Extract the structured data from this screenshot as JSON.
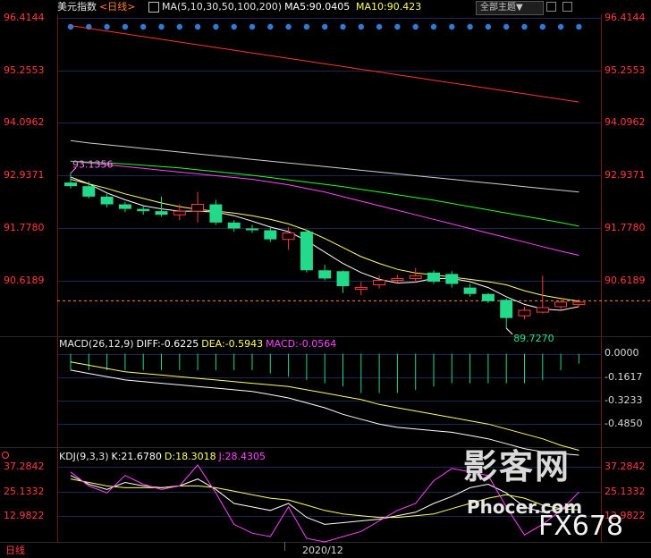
{
  "main_header": {
    "instrument": "美元指数",
    "period": "<日线>",
    "ma_label": "MA(5,10,30,50,100,200)",
    "ma5": "MA5:90.0405",
    "ma10": "MA10:90.423"
  },
  "theme_select": {
    "value": "全部主题▼"
  },
  "toolbar_icons": [
    "settings-icon",
    "close-icon"
  ],
  "price_axis_ticks": [
    "96.4144",
    "95.2553",
    "94.0962",
    "92.9371",
    "91.7780",
    "90.6189"
  ],
  "macd_header": {
    "label": "MACD(26,12,9)",
    "dif": "DIFF:-0.6225",
    "dea": "DEA:-0.5943",
    "macd": "MACD:-0.0564"
  },
  "macd_axis_ticks": [
    "0.0000",
    "-0.1617",
    "-0.3233",
    "-0.4850"
  ],
  "kdj_header": {
    "label": "KDJ(9,3,3)",
    "k": "K:21.6780",
    "d": "D:18.3018",
    "j": "J:28.4305"
  },
  "kdj_axis_ticks": [
    "37.2842",
    "25.1332",
    "12.9822"
  ],
  "footer": {
    "period_label": "日线",
    "date_label": "2020/12"
  },
  "watermark": {
    "main": "影客网",
    "site": "Phocer.com",
    "code": "FX678"
  },
  "colors": {
    "up": "#ff3b3b",
    "down": "#23d98a",
    "ma5": "#ffffff",
    "ma10": "#ffff66",
    "ma30": "#ff44ff",
    "ma50": "#22ff22",
    "ma100": "#d0d0d0",
    "ma200": "#ff3333",
    "dif": "#ffffff",
    "dea": "#ffff66",
    "k": "#ffffff",
    "d": "#ffff66",
    "j": "#ff44ff"
  },
  "chart_data": [
    {
      "type": "candlestick",
      "title": "美元指数 <日线>",
      "ylim": [
        89.55,
        96.55
      ],
      "annotations": [
        {
          "text": "93.1356",
          "kind": "high",
          "bar": 0,
          "value": 93.1356
        },
        {
          "text": "89.7270",
          "kind": "low",
          "bar": 24,
          "value": 89.727
        }
      ],
      "last_price_line": 90.33,
      "candles": [
        {
          "o": 92.93,
          "c": 92.85,
          "h": 93.1356,
          "l": 92.8
        },
        {
          "o": 92.85,
          "c": 92.62,
          "h": 92.95,
          "l": 92.58
        },
        {
          "o": 92.62,
          "c": 92.45,
          "h": 92.68,
          "l": 92.38
        },
        {
          "o": 92.45,
          "c": 92.35,
          "h": 92.5,
          "l": 92.28
        },
        {
          "o": 92.35,
          "c": 92.3,
          "h": 92.42,
          "l": 92.22
        },
        {
          "o": 92.3,
          "c": 92.22,
          "h": 92.62,
          "l": 92.18
        },
        {
          "o": 92.22,
          "c": 92.3,
          "h": 92.45,
          "l": 92.1
        },
        {
          "o": 92.3,
          "c": 92.45,
          "h": 92.72,
          "l": 92.05
        },
        {
          "o": 92.45,
          "c": 92.05,
          "h": 92.55,
          "l": 92.0
        },
        {
          "o": 92.05,
          "c": 91.92,
          "h": 92.1,
          "l": 91.85
        },
        {
          "o": 91.92,
          "c": 91.88,
          "h": 92.0,
          "l": 91.82
        },
        {
          "o": 91.88,
          "c": 91.68,
          "h": 91.95,
          "l": 91.62
        },
        {
          "o": 91.68,
          "c": 91.82,
          "h": 91.95,
          "l": 91.45
        },
        {
          "o": 91.85,
          "c": 91.0,
          "h": 91.9,
          "l": 90.95
        },
        {
          "o": 91.0,
          "c": 90.82,
          "h": 91.12,
          "l": 90.78
        },
        {
          "o": 90.98,
          "c": 90.65,
          "h": 91.0,
          "l": 90.5
        },
        {
          "o": 90.58,
          "c": 90.62,
          "h": 90.75,
          "l": 90.45
        },
        {
          "o": 90.68,
          "c": 90.78,
          "h": 90.88,
          "l": 90.6
        },
        {
          "o": 90.78,
          "c": 90.82,
          "h": 90.9,
          "l": 90.72
        },
        {
          "o": 90.82,
          "c": 90.88,
          "h": 91.05,
          "l": 90.72
        },
        {
          "o": 90.95,
          "c": 90.75,
          "h": 91.0,
          "l": 90.7
        },
        {
          "o": 90.92,
          "c": 90.7,
          "h": 90.98,
          "l": 90.62
        },
        {
          "o": 90.62,
          "c": 90.48,
          "h": 90.7,
          "l": 90.42
        },
        {
          "o": 90.48,
          "c": 90.32,
          "h": 90.5,
          "l": 90.28
        },
        {
          "o": 90.35,
          "c": 89.95,
          "h": 90.38,
          "l": 89.727
        },
        {
          "o": 90.0,
          "c": 90.12,
          "h": 90.2,
          "l": 89.92
        },
        {
          "o": 90.08,
          "c": 90.18,
          "h": 90.88,
          "l": 90.05
        },
        {
          "o": 90.2,
          "c": 90.3,
          "h": 90.35,
          "l": 90.12
        },
        {
          "o": 90.25,
          "c": 90.3,
          "h": 90.36,
          "l": 90.22
        }
      ],
      "moving_averages": [
        {
          "name": "MA5",
          "values": [
            93.05,
            92.9,
            92.7,
            92.55,
            92.42,
            92.35,
            92.3,
            92.3,
            92.28,
            92.2,
            92.08,
            91.95,
            91.85,
            91.65,
            91.4,
            91.15,
            90.95,
            90.8,
            90.72,
            90.74,
            90.82,
            90.82,
            90.75,
            90.62,
            90.42,
            90.25,
            90.15,
            90.12,
            90.2
          ]
        },
        {
          "name": "MA10",
          "values": [
            93.0,
            92.9,
            92.8,
            92.68,
            92.58,
            92.48,
            92.4,
            92.34,
            92.3,
            92.26,
            92.2,
            92.12,
            92.02,
            91.88,
            91.7,
            91.5,
            91.3,
            91.15,
            91.02,
            90.94,
            90.9,
            90.85,
            90.8,
            90.75,
            90.68,
            90.55,
            90.45,
            90.38,
            90.32
          ]
        },
        {
          "name": "MA30",
          "values": [
            93.4,
            93.36,
            93.32,
            93.28,
            93.24,
            93.2,
            93.16,
            93.12,
            93.08,
            93.04,
            93.0,
            92.94,
            92.88,
            92.8,
            92.72,
            92.62,
            92.52,
            92.42,
            92.32,
            92.22,
            92.12,
            92.02,
            91.92,
            91.82,
            91.72,
            91.62,
            91.52,
            91.42,
            91.33
          ]
        },
        {
          "name": "MA50",
          "values": [
            93.4,
            93.38,
            93.36,
            93.34,
            93.31,
            93.28,
            93.25,
            93.21,
            93.17,
            93.13,
            93.09,
            93.04,
            92.99,
            92.94,
            92.89,
            92.84,
            92.78,
            92.72,
            92.66,
            92.6,
            92.54,
            92.47,
            92.4,
            92.33,
            92.26,
            92.19,
            92.12,
            92.05,
            91.97
          ]
        },
        {
          "name": "MA100",
          "values": [
            93.85,
            93.8,
            93.76,
            93.72,
            93.68,
            93.64,
            93.6,
            93.56,
            93.52,
            93.48,
            93.44,
            93.4,
            93.36,
            93.32,
            93.28,
            93.24,
            93.2,
            93.16,
            93.12,
            93.08,
            93.04,
            93.0,
            92.96,
            92.92,
            92.88,
            92.84,
            92.8,
            92.76,
            92.72
          ]
        },
        {
          "name": "MA200",
          "values": [
            96.38,
            96.32,
            96.26,
            96.2,
            96.14,
            96.08,
            96.02,
            95.96,
            95.9,
            95.84,
            95.78,
            95.72,
            95.66,
            95.6,
            95.54,
            95.48,
            95.42,
            95.36,
            95.3,
            95.24,
            95.18,
            95.12,
            95.06,
            95.0,
            94.94,
            94.88,
            94.82,
            94.76,
            94.7
          ]
        }
      ]
    },
    {
      "type": "line",
      "title": "MACD(26,12,9)",
      "ylim": [
        -0.56,
        0.02
      ],
      "series": [
        {
          "name": "DIFF",
          "values": [
            -0.1,
            -0.12,
            -0.14,
            -0.16,
            -0.17,
            -0.18,
            -0.19,
            -0.2,
            -0.21,
            -0.22,
            -0.23,
            -0.25,
            -0.27,
            -0.3,
            -0.33,
            -0.37,
            -0.4,
            -0.43,
            -0.45,
            -0.46,
            -0.47,
            -0.48,
            -0.5,
            -0.52,
            -0.55,
            -0.58,
            -0.6,
            -0.61,
            -0.62
          ]
        },
        {
          "name": "DEA",
          "values": [
            -0.05,
            -0.07,
            -0.09,
            -0.11,
            -0.12,
            -0.13,
            -0.14,
            -0.15,
            -0.16,
            -0.17,
            -0.18,
            -0.19,
            -0.2,
            -0.22,
            -0.24,
            -0.26,
            -0.28,
            -0.31,
            -0.33,
            -0.35,
            -0.37,
            -0.39,
            -0.41,
            -0.43,
            -0.46,
            -0.49,
            -0.52,
            -0.56,
            -0.59
          ]
        },
        {
          "name": "MACD",
          "values": [
            -0.1,
            -0.1,
            -0.1,
            -0.1,
            -0.1,
            -0.1,
            -0.1,
            -0.1,
            -0.1,
            -0.1,
            -0.1,
            -0.12,
            -0.14,
            -0.16,
            -0.18,
            -0.2,
            -0.24,
            -0.24,
            -0.24,
            -0.22,
            -0.2,
            -0.18,
            -0.18,
            -0.18,
            -0.18,
            -0.18,
            -0.16,
            -0.1,
            -0.06
          ]
        }
      ]
    },
    {
      "type": "line",
      "title": "KDJ(9,3,3)",
      "ylim": [
        0,
        45
      ],
      "series": [
        {
          "name": "K",
          "values": [
            38,
            33,
            30,
            34,
            32,
            31,
            32,
            36,
            30,
            22,
            20,
            18,
            22,
            14,
            10,
            11,
            12,
            13,
            15,
            17,
            22,
            26,
            31,
            33,
            28,
            20,
            17,
            19,
            21.678
          ]
        },
        {
          "name": "D",
          "values": [
            36,
            34,
            32,
            31,
            31,
            31,
            32,
            32,
            31,
            29,
            27,
            25,
            24,
            21,
            18,
            16,
            15,
            14,
            14,
            15,
            16,
            19,
            22,
            25,
            27,
            25,
            21,
            19,
            18.3018
          ]
        },
        {
          "name": "J",
          "values": [
            40,
            32,
            28,
            38,
            33,
            30,
            32,
            44,
            28,
            10,
            5,
            3,
            20,
            2,
            0,
            3,
            6,
            12,
            18,
            22,
            35,
            42,
            40,
            38,
            20,
            4,
            10,
            18,
            28.4305
          ]
        }
      ]
    }
  ]
}
